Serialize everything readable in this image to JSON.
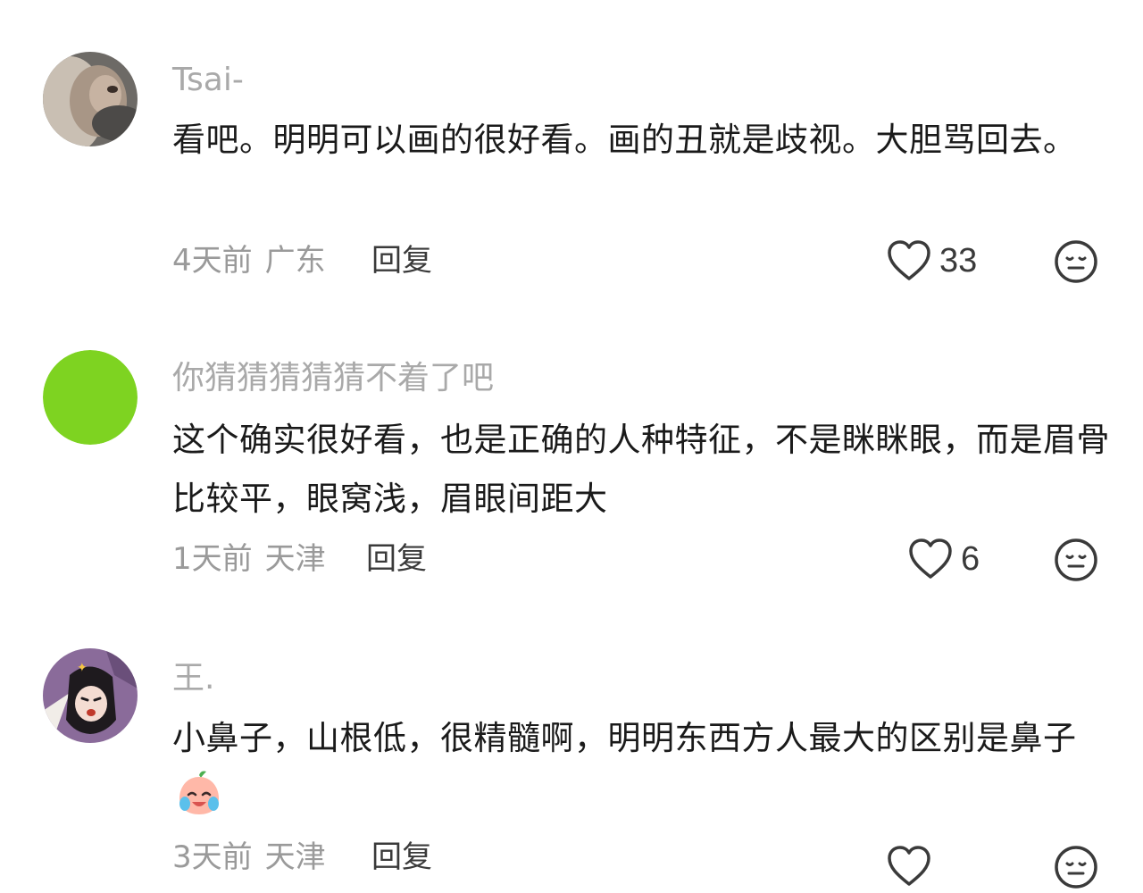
{
  "comments": [
    {
      "author": "Tsai-",
      "text": "看吧。明明可以画的很好看。画的丑就是歧视。大胆骂回去。",
      "time": "4天前",
      "location": "广东",
      "reply_label": "回复",
      "likes": "33",
      "avatar_icon": "bunny-photo-avatar"
    },
    {
      "author": "你猜猜猜猜猜不着了吧",
      "text": "这个确实很好看，也是正确的人种特征，不是眯眯眼，而是眉骨比较平，眼窝浅，眉眼间距大",
      "time": "1天前",
      "location": "天津",
      "reply_label": "回复",
      "likes": "6",
      "avatar_icon": "green-circle-avatar",
      "avatar_color": "#7ed321"
    },
    {
      "author": "王.",
      "text": "小鼻子，山根低，很精髓啊，明明东西方人最大的区别是鼻子",
      "emoji": "crying-laughing-peach-emoji",
      "time": "3天前",
      "location": "天津",
      "reply_label": "回复",
      "avatar_icon": "anime-character-avatar",
      "avatar_color": "#8a6b9a"
    }
  ],
  "colors": {
    "author": "#a9a9a9",
    "meta": "#9a9a9a",
    "text": "#1a1a1a",
    "icon": "#3a3a3a"
  }
}
